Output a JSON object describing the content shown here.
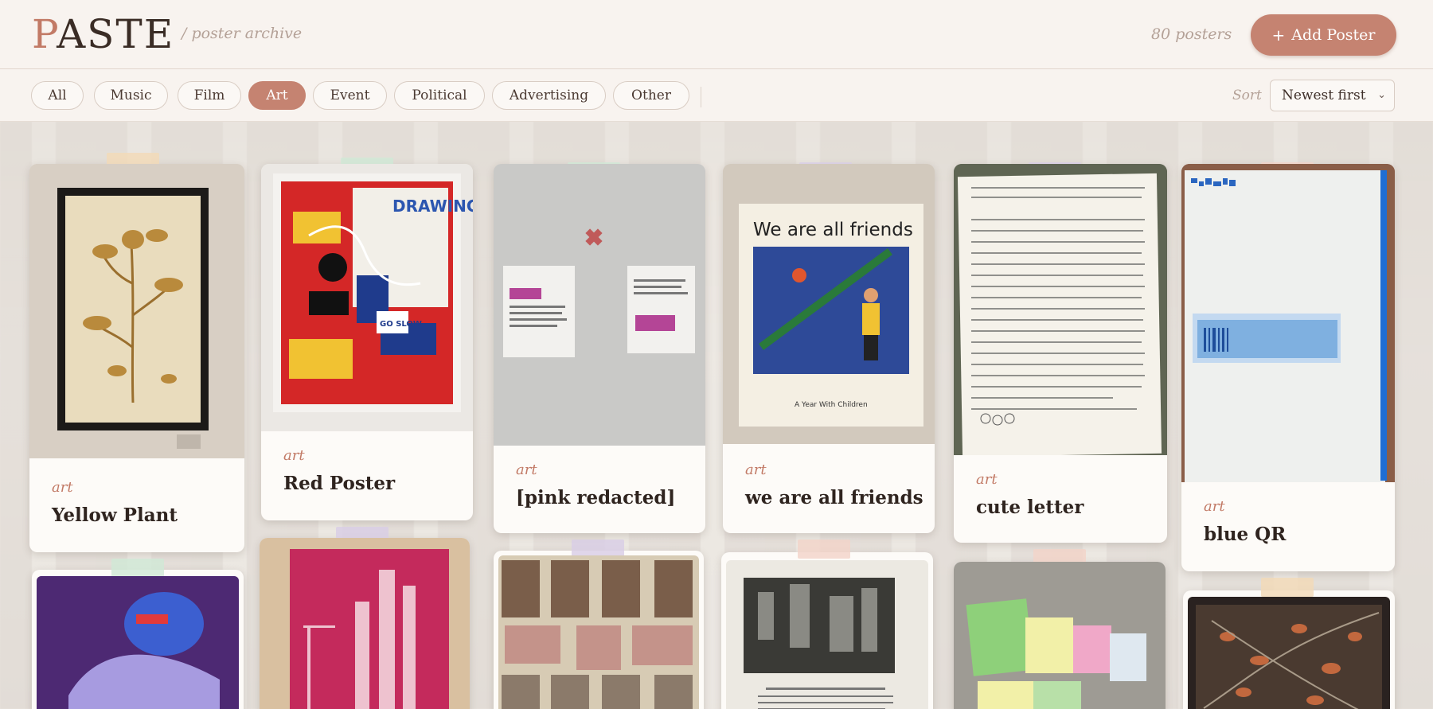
{
  "app": {
    "logo": "PASTE",
    "logo_first": "P",
    "logo_rest": "ASTE",
    "subtitle": "/ poster archive",
    "count": "80 posters",
    "add_button": "Add Poster",
    "add_icon": "+"
  },
  "filters": {
    "items": [
      "All",
      "Music",
      "Film",
      "Art",
      "Event",
      "Political",
      "Advertising",
      "Other"
    ],
    "active": "Art"
  },
  "sort": {
    "label": "Sort",
    "value": "Newest first"
  },
  "posters": [
    {
      "category": "art",
      "title": "Yellow Plant"
    },
    {
      "category": "art",
      "title": "Red Poster"
    },
    {
      "category": "art",
      "title": "[pink redacted]"
    },
    {
      "category": "art",
      "title": "we are all friends"
    },
    {
      "category": "art",
      "title": "cute letter"
    },
    {
      "category": "art",
      "title": "blue QR"
    }
  ],
  "poster_art": {
    "friends_heading": "We are all friends",
    "friends_caption": "A Year With Children",
    "red_poster_words": [
      "DRAWING",
      "GO SLOW"
    ]
  },
  "colors": {
    "accent": "#c58371",
    "accent_text": "#c27a66",
    "background": "#f8f3ef"
  }
}
